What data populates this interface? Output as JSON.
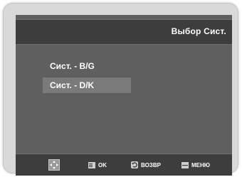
{
  "header": {
    "title": "Выбор Сист."
  },
  "menu": {
    "items": [
      {
        "label": "Сист. - B/G",
        "selected": false
      },
      {
        "label": "Сист. - D/K",
        "selected": true
      }
    ]
  },
  "footer": {
    "ok_label": "OK",
    "back_label": "ВОЗВР",
    "menu_label": "МЕНЮ"
  },
  "colors": {
    "screen_bg": "#5f5f5f",
    "bar_bg": "#3d3d3d",
    "highlight": "#7a7a7a",
    "text": "#ffffff"
  }
}
